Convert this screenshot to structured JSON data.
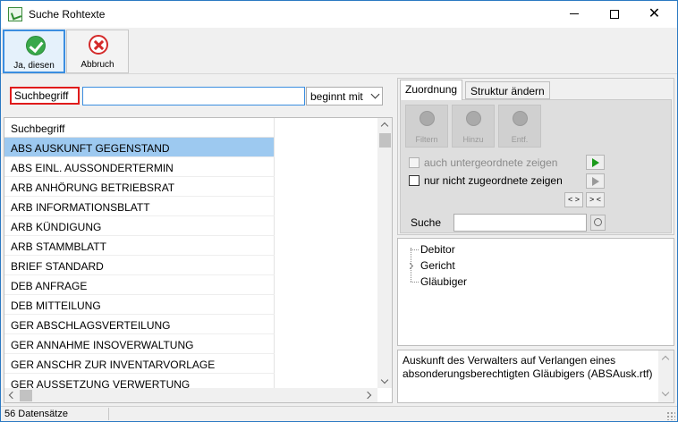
{
  "window": {
    "title": "Suche Rohtexte"
  },
  "toolbar": {
    "ok_label": "Ja, diesen",
    "cancel_label": "Abbruch"
  },
  "search": {
    "label": "Suchbegriff",
    "value": "",
    "mode": "beginnt mit"
  },
  "grid": {
    "header": "Suchbegriff",
    "rows": [
      "ABS AUSKUNFT GEGENSTAND",
      "ABS EINL. AUSSONDERTERMIN",
      "ARB ANHÖRUNG BETRIEBSRAT",
      "ARB INFORMATIONSBLATT",
      "ARB KÜNDIGUNG",
      "ARB STAMMBLATT",
      "BRIEF STANDARD",
      "DEB ANFRAGE",
      "DEB MITTEILUNG",
      "GER ABSCHLAGSVERTEILUNG",
      "GER ANNAHME INSOVERWALTUNG",
      "GER ANSCHR ZUR INVENTARVORLAGE",
      "GER AUSSETZUNG VERWERTUNG"
    ],
    "selected_index": 0
  },
  "tabs": {
    "assign": "Zuordnung",
    "change": "Struktur ändern"
  },
  "actions": {
    "filter": "Filtern",
    "add": "Hinzu",
    "remove": "Entf."
  },
  "options": {
    "show_children": "auch untergeordnete zeigen",
    "show_unassigned": "nur nicht zugeordnete zeigen",
    "expand": "< >",
    "collapse": "> <"
  },
  "tree_search": {
    "label": "Suche",
    "value": ""
  },
  "tree": {
    "nodes": [
      "Debitor",
      "Gericht",
      "Gläubiger"
    ]
  },
  "description": "Auskunft des Verwalters auf Verlangen eines absonderungsberechtigten Gläubigers (ABSAusk.rtf)",
  "status": {
    "count": "56 Datensätze"
  }
}
